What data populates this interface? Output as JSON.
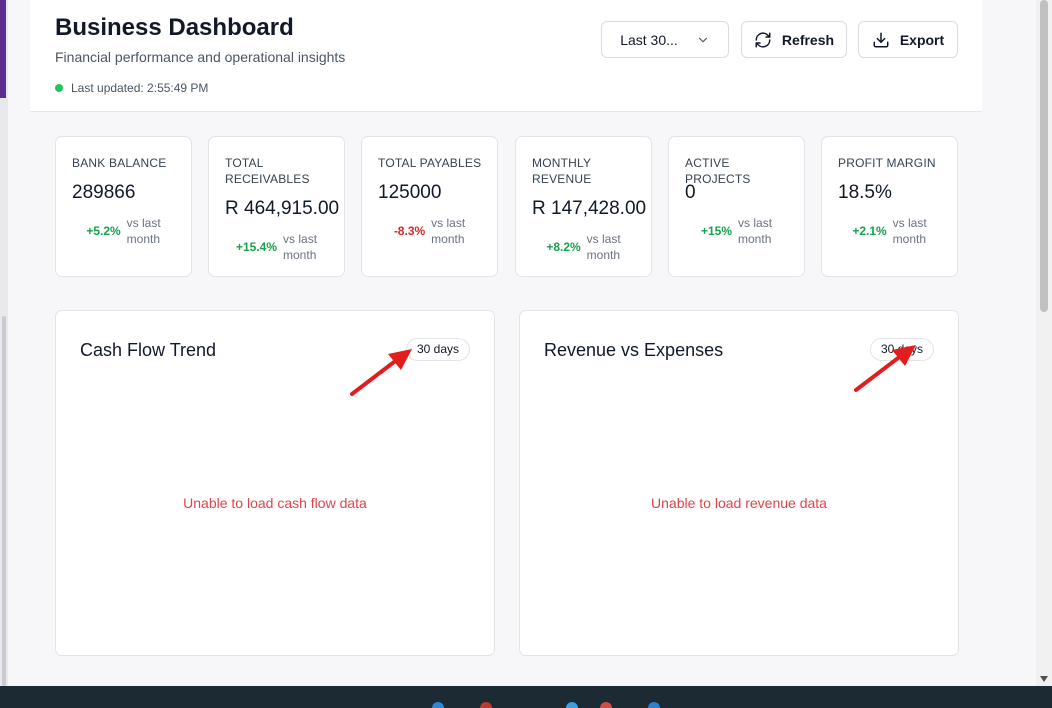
{
  "header": {
    "title": "Business Dashboard",
    "subtitle": "Financial performance and operational insights",
    "last_updated": "Last updated: 2:55:49 PM",
    "range_select": {
      "value": "Last 30..."
    },
    "refresh_label": "Refresh",
    "export_label": "Export"
  },
  "stats": [
    {
      "label": "BANK BALANCE",
      "value": "289866",
      "change": "+5.2%",
      "direction": "up",
      "vs": "vs last month"
    },
    {
      "label": "TOTAL RECEIVABLES",
      "value": "R 464,915.00",
      "change": "+15.4%",
      "direction": "up",
      "vs": "vs last month"
    },
    {
      "label": "TOTAL PAYABLES",
      "value": "125000",
      "change": "-8.3%",
      "direction": "down",
      "vs": "vs last month"
    },
    {
      "label": "MONTHLY REVENUE",
      "value": "R 147,428.00",
      "change": "+8.2%",
      "direction": "up",
      "vs": "vs last month"
    },
    {
      "label": "ACTIVE PROJECTS",
      "value": "0",
      "change": "+15%",
      "direction": "up",
      "vs": "vs last month"
    },
    {
      "label": "PROFIT MARGIN",
      "value": "18.5%",
      "change": "+2.1%",
      "direction": "up",
      "vs": "vs last month"
    }
  ],
  "cards": {
    "cashflow": {
      "title": "Cash Flow Trend",
      "badge": "30 days",
      "error": "Unable to load cash flow data"
    },
    "revenue": {
      "title": "Revenue vs Expenses",
      "badge": "30 days",
      "error": "Unable to load revenue data"
    }
  },
  "colors": {
    "positive": "#16a34a",
    "negative": "#dc2626",
    "error_text": "#e0434a",
    "status_dot": "#22c55e",
    "annotation_arrow": "#e11d1d"
  }
}
